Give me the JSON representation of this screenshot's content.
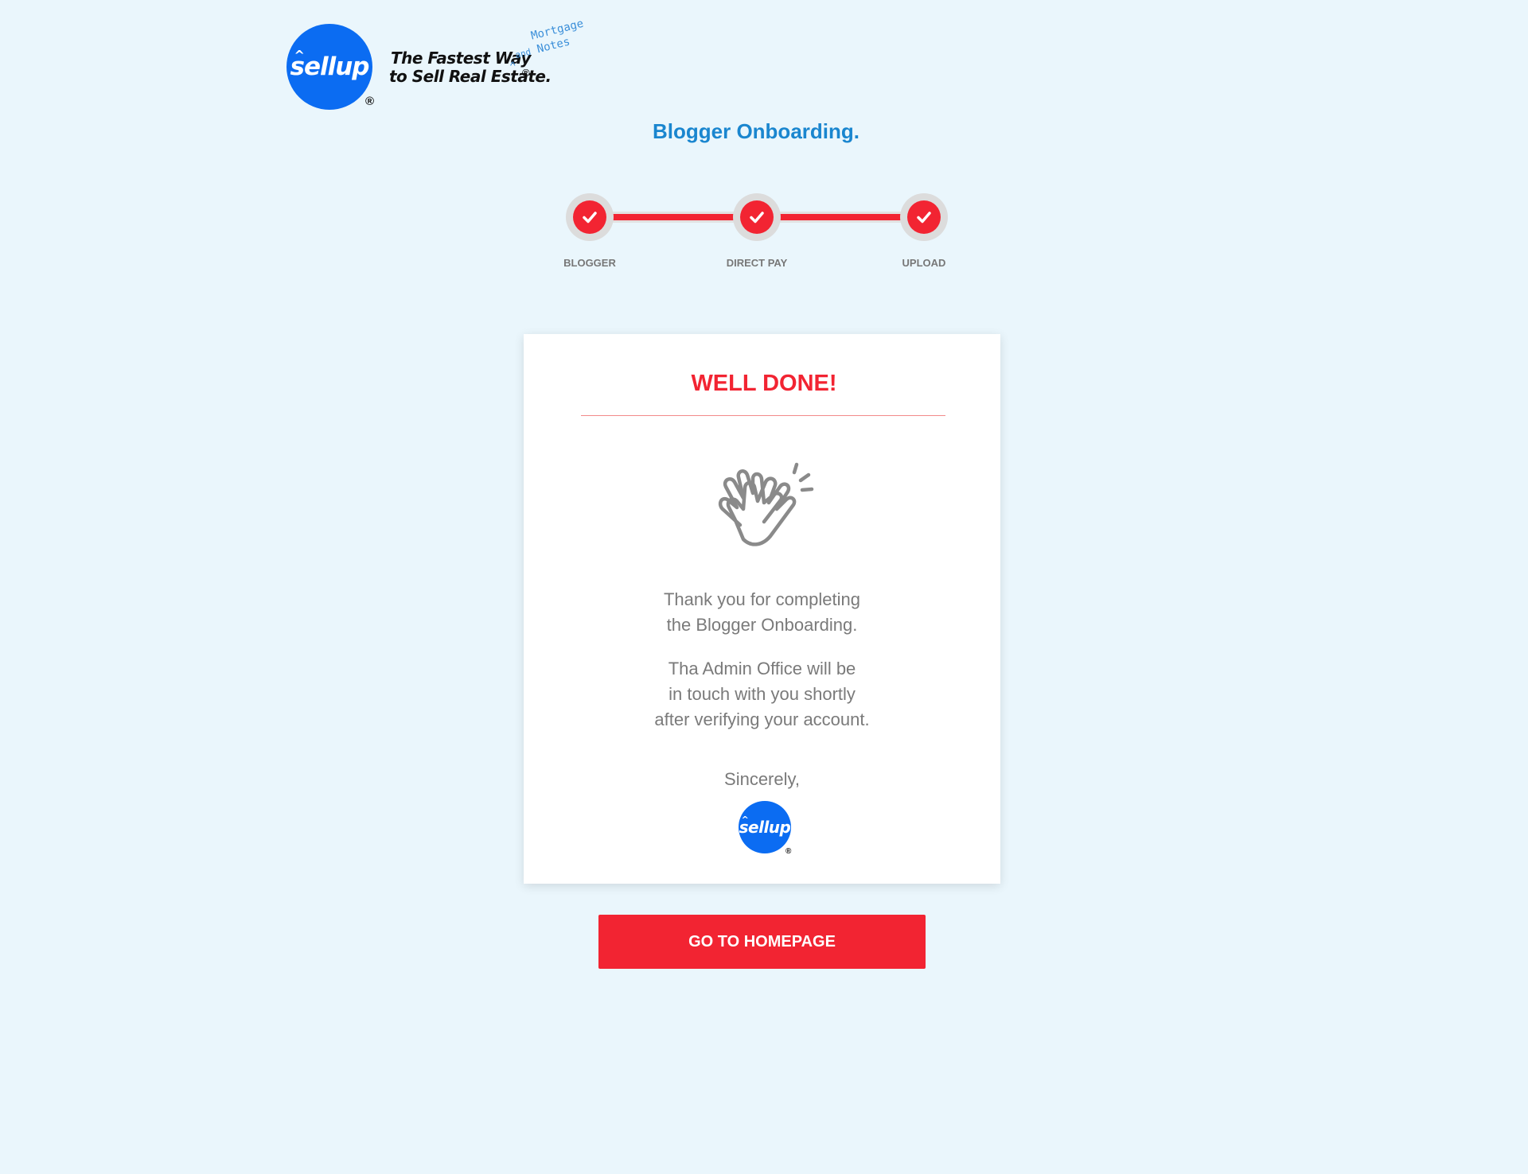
{
  "brand": {
    "logo_text": "sellup",
    "registered": "®",
    "tagline_line1": "The Fastest Way",
    "tagline_line2": "to Sell Real Estate.",
    "tagline_addon_and": "and",
    "tagline_addon_mortgage": "Mortgage",
    "tagline_addon_notes": "Notes",
    "primary_color": "#0b6cf2"
  },
  "page": {
    "title": "Blogger Onboarding.",
    "title_color": "#1a86cf",
    "background": "#eaf6fc"
  },
  "stepper": {
    "accent_color": "#f22432",
    "steps": [
      {
        "label": "BLOGGER",
        "completed": true,
        "icon": "check-icon"
      },
      {
        "label": "DIRECT PAY",
        "completed": true,
        "icon": "check-icon"
      },
      {
        "label": "UPLOAD",
        "completed": true,
        "icon": "check-icon"
      }
    ]
  },
  "card": {
    "title": "WELL DONE!",
    "illustration": "clapping-hands-icon",
    "thanks_line1": "Thank you for completing",
    "thanks_line2": "the Blogger Onboarding.",
    "info_line1": "Tha Admin Office will be",
    "info_line2": "in touch with you shortly",
    "info_line3": "after verifying your account.",
    "sincerely": "Sincerely,",
    "signature_logo_text": "sellup"
  },
  "actions": {
    "home_button_label": "GO TO HOMEPAGE",
    "home_button_color": "#f22432"
  }
}
